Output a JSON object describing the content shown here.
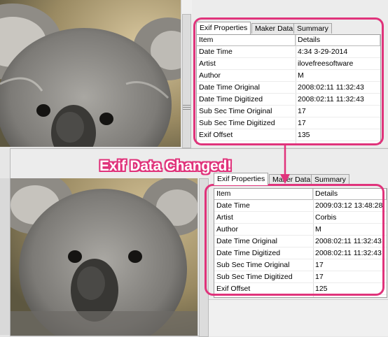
{
  "headline": "Exif Data Changed!",
  "accent_color": "#e0337b",
  "before": {
    "tabs": [
      "Exif Properties",
      "Maker Data",
      "Summary"
    ],
    "columns": [
      "Item",
      "Details"
    ],
    "rows": [
      {
        "item": "Date Time",
        "details": "4:34 3-29-2014"
      },
      {
        "item": "Artist",
        "details": "ilovefreesoftware"
      },
      {
        "item": "Author",
        "details": "M"
      },
      {
        "item": "Date Time Original",
        "details": "2008:02:11 11:32:43"
      },
      {
        "item": "Date Time Digitized",
        "details": "2008:02:11 11:32:43"
      },
      {
        "item": "Sub Sec Time Original",
        "details": "17"
      },
      {
        "item": "Sub Sec Time Digitized",
        "details": "17"
      },
      {
        "item": "Exif Offset",
        "details": "135"
      }
    ]
  },
  "after": {
    "tabs": [
      "Exif Properties",
      "Maker Data",
      "Summary"
    ],
    "columns": [
      "Item",
      "Details"
    ],
    "rows": [
      {
        "item": "Date Time",
        "details": "2009:03:12 13:48:28"
      },
      {
        "item": "Artist",
        "details": "Corbis"
      },
      {
        "item": "Author",
        "details": "M"
      },
      {
        "item": "Date Time Original",
        "details": "2008:02:11 11:32:43"
      },
      {
        "item": "Date Time Digitized",
        "details": "2008:02:11 11:32:43"
      },
      {
        "item": "Sub Sec Time Original",
        "details": "17"
      },
      {
        "item": "Sub Sec Time Digitized",
        "details": "17"
      },
      {
        "item": "Exif Offset",
        "details": "125"
      }
    ]
  }
}
